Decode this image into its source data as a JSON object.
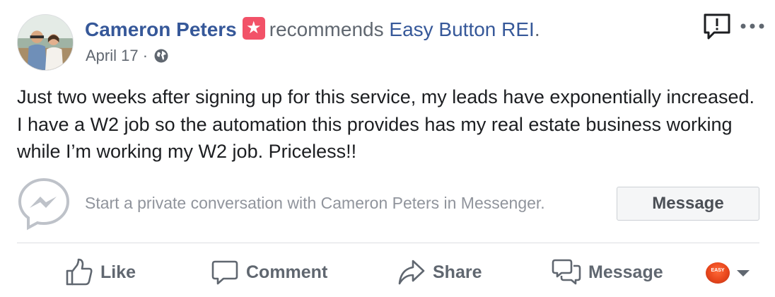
{
  "header": {
    "author_name": "Cameron Peters",
    "recommends_verb": "recommends",
    "page_name": "Easy Button REI",
    "period": ".",
    "badge_icon": "star-icon",
    "badge_color": "#f25268"
  },
  "meta": {
    "date": "April 17",
    "separator": "·",
    "privacy_icon": "globe-icon"
  },
  "post": {
    "text": "Just two weeks after signing up for this service, my leads have exponentially increased. I have a W2 job so the automation this provides has my real estate business working while I’m working my W2 job. Priceless!!"
  },
  "messenger_prompt": {
    "text": "Start a private conversation with Cameron Peters in Messenger.",
    "button_label": "Message"
  },
  "actions": {
    "like": "Like",
    "comment": "Comment",
    "share": "Share",
    "message": "Message"
  },
  "colors": {
    "link_blue": "#365899",
    "secondary_text": "#606770",
    "muted_text": "#90949c",
    "divider": "#dddfe2"
  },
  "page_selector": {
    "thumbnail_text": "EASY"
  }
}
